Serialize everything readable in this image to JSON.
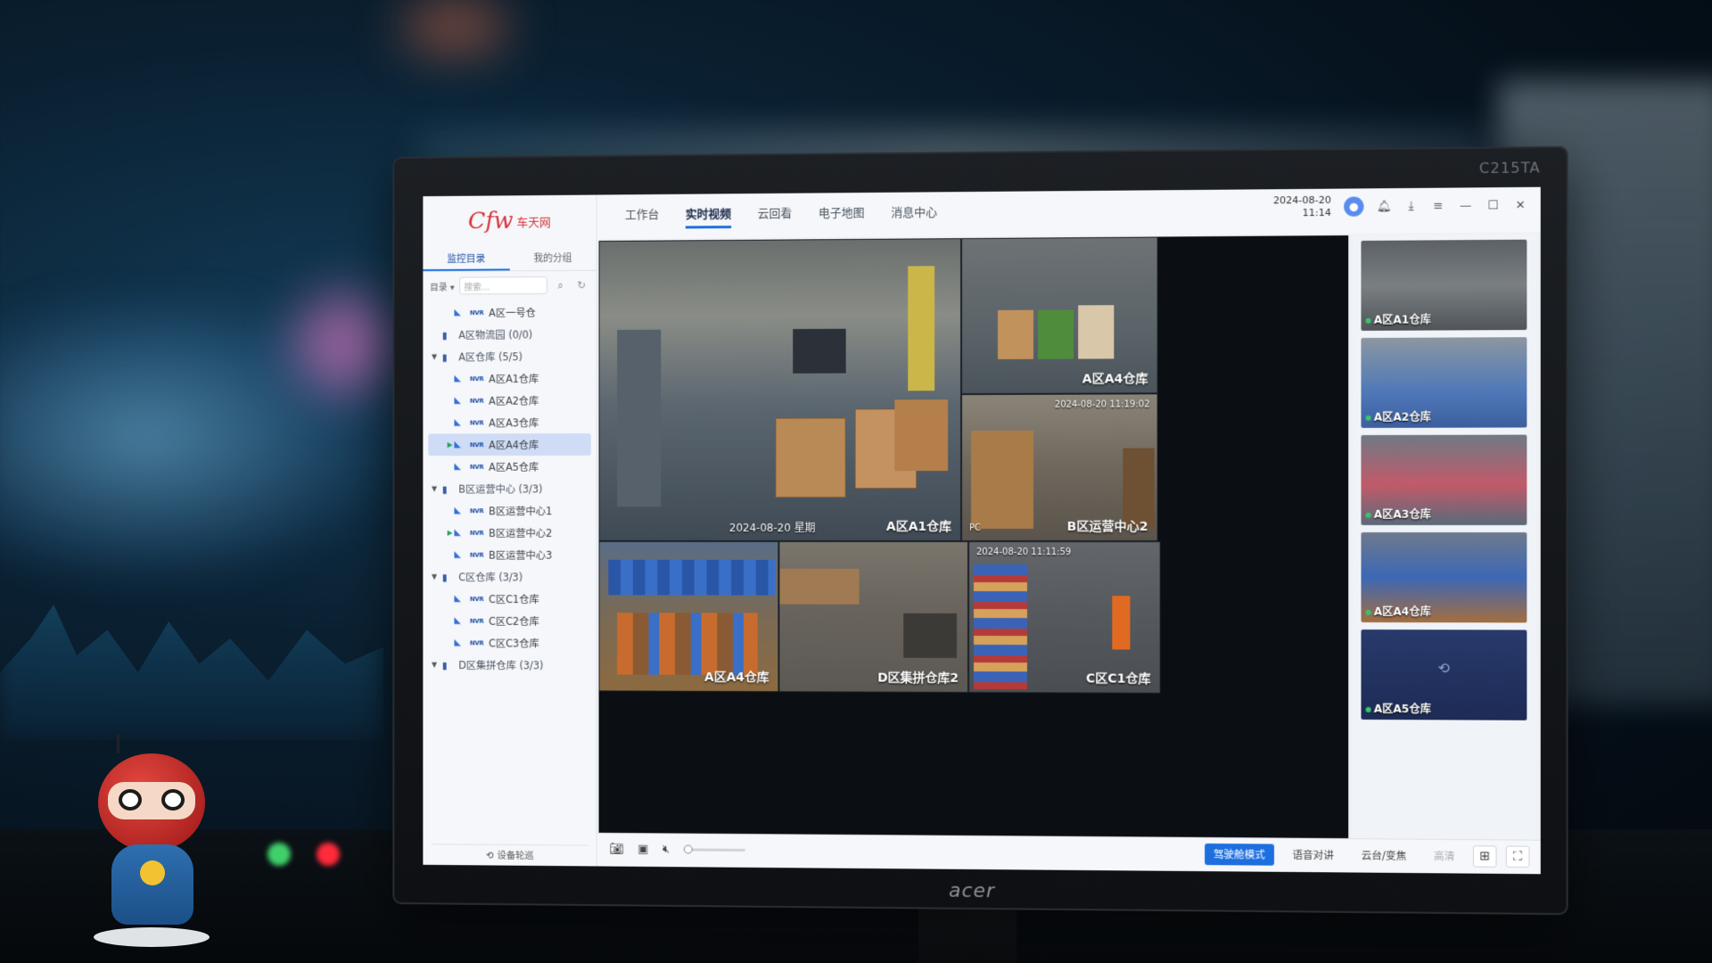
{
  "monitor": {
    "model": "C215TA",
    "brand": "acer"
  },
  "app": {
    "logo_text": "Cfw",
    "logo_subtext": "车天网",
    "side_tabs": [
      "监控目录",
      "我的分组"
    ],
    "directory_label": "目录",
    "search_placeholder": "搜索...",
    "tree": [
      {
        "type": "camera",
        "label": "A区一号仓"
      },
      {
        "type": "group",
        "label": "A区物流园 (0/0)",
        "expanded": false
      },
      {
        "type": "group",
        "label": "A区仓库 (5/5)",
        "expanded": true
      },
      {
        "type": "camera",
        "label": "A区A1仓库"
      },
      {
        "type": "camera",
        "label": "A区A2仓库"
      },
      {
        "type": "camera",
        "label": "A区A3仓库"
      },
      {
        "type": "camera",
        "label": "A区A4仓库",
        "selected": true,
        "playing": true
      },
      {
        "type": "camera",
        "label": "A区A5仓库"
      },
      {
        "type": "group",
        "label": "B区运营中心 (3/3)",
        "expanded": true
      },
      {
        "type": "camera",
        "label": "B区运营中心1"
      },
      {
        "type": "camera",
        "label": "B区运营中心2",
        "playing": true
      },
      {
        "type": "camera",
        "label": "B区运营中心3"
      },
      {
        "type": "group",
        "label": "C区仓库 (3/3)",
        "expanded": true
      },
      {
        "type": "camera",
        "label": "C区C1仓库"
      },
      {
        "type": "camera",
        "label": "C区C2仓库"
      },
      {
        "type": "camera",
        "label": "C区C3仓库"
      },
      {
        "type": "group",
        "label": "D区集拼仓库 (3/3)",
        "expanded": true
      }
    ],
    "device_patrol_label": "设备轮巡",
    "nav": [
      "工作台",
      "实时视频",
      "云回看",
      "电子地图",
      "消息中心"
    ],
    "nav_active": "实时视频",
    "date": "2024-08-20",
    "time": "11:14",
    "tiles": [
      {
        "label": "A区A1仓库",
        "date": "2024-08-20  星期"
      },
      {
        "label": "A区A4仓库"
      },
      {
        "label": "B区运营中心2",
        "time": "2024-08-20 11:19:02",
        "corner": "PC"
      },
      {
        "label": "A区A4仓库"
      },
      {
        "label": "D区集拼仓库2"
      },
      {
        "label": "C区C1仓库",
        "time": "2024-08-20 11:11:59"
      }
    ],
    "previews": [
      {
        "label": "A区A1仓库",
        "online": true
      },
      {
        "label": "A区A2仓库",
        "online": true
      },
      {
        "label": "A区A3仓库",
        "online": true
      },
      {
        "label": "A区A4仓库",
        "online": true
      },
      {
        "label": "A区A5仓库",
        "online": true,
        "offline_view": true
      }
    ],
    "toolbar": {
      "cockpit_mode": "驾驶舱模式",
      "voice_talk": "语音对讲",
      "ptz": "云台/变焦",
      "hd": "高清"
    }
  },
  "colors": {
    "accent": "#1d6fe0",
    "logo": "#d8323a",
    "online": "#38c46a"
  }
}
